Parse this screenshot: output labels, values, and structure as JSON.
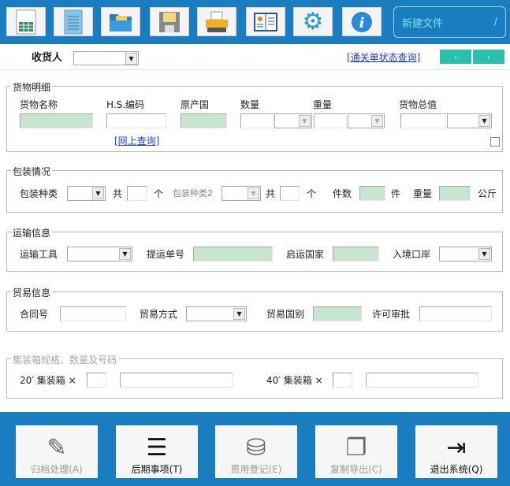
{
  "toolbar": {
    "buttons": [
      {
        "icon": "spreadsheet-icon"
      },
      {
        "icon": "document-icon"
      },
      {
        "icon": "folder-open-icon"
      },
      {
        "icon": "save-icon"
      },
      {
        "icon": "printer-icon"
      },
      {
        "icon": "address-book-icon"
      },
      {
        "icon": "gear-icon"
      },
      {
        "icon": "info-icon"
      }
    ],
    "file_name": "新建文件",
    "file_suffix": "/"
  },
  "header": {
    "consignee_label": "收货人",
    "status_link": "[通关单状态查询]",
    "prev": "‹",
    "next": "›"
  },
  "goods": {
    "legend": "货物明细",
    "name": "货物名称",
    "hs": "H.S.编码",
    "origin": "原产国",
    "qty": "数量",
    "weight": "重量",
    "total": "货物总值",
    "online_link": "[网上查询]"
  },
  "packing": {
    "legend": "包装情况",
    "type": "包装种类",
    "total1": "共",
    "unit1": "个",
    "type2": "包装种类2",
    "total2": "共",
    "unit2": "个",
    "pieces": "件数",
    "pieces_unit": "件",
    "weight": "重量",
    "weight_unit": "公斤"
  },
  "transport": {
    "legend": "运输信息",
    "tool": "运输工具",
    "bill": "提运单号",
    "country": "启运国家",
    "port": "入境口岸"
  },
  "trade": {
    "legend": "贸易信息",
    "contract": "合同号",
    "mode": "贸易方式",
    "country": "贸易国别",
    "license": "许可审批"
  },
  "container": {
    "legend": "集装箱规格、数量及号码",
    "c20": "20′ 集装箱 ×",
    "c40": "40′ 集装箱 ×"
  },
  "bottom": [
    {
      "label": "归档处理(A)",
      "enabled": false
    },
    {
      "label": "后期事项(T)",
      "enabled": true
    },
    {
      "label": "费用登记(E)",
      "enabled": false
    },
    {
      "label": "复制导出(C)",
      "enabled": false
    },
    {
      "label": "退出系统(Q)",
      "enabled": true
    }
  ],
  "colors": {
    "bar": "#1a7dc0",
    "field_green": "#c8e6cf",
    "nav": "#2bbfae"
  }
}
